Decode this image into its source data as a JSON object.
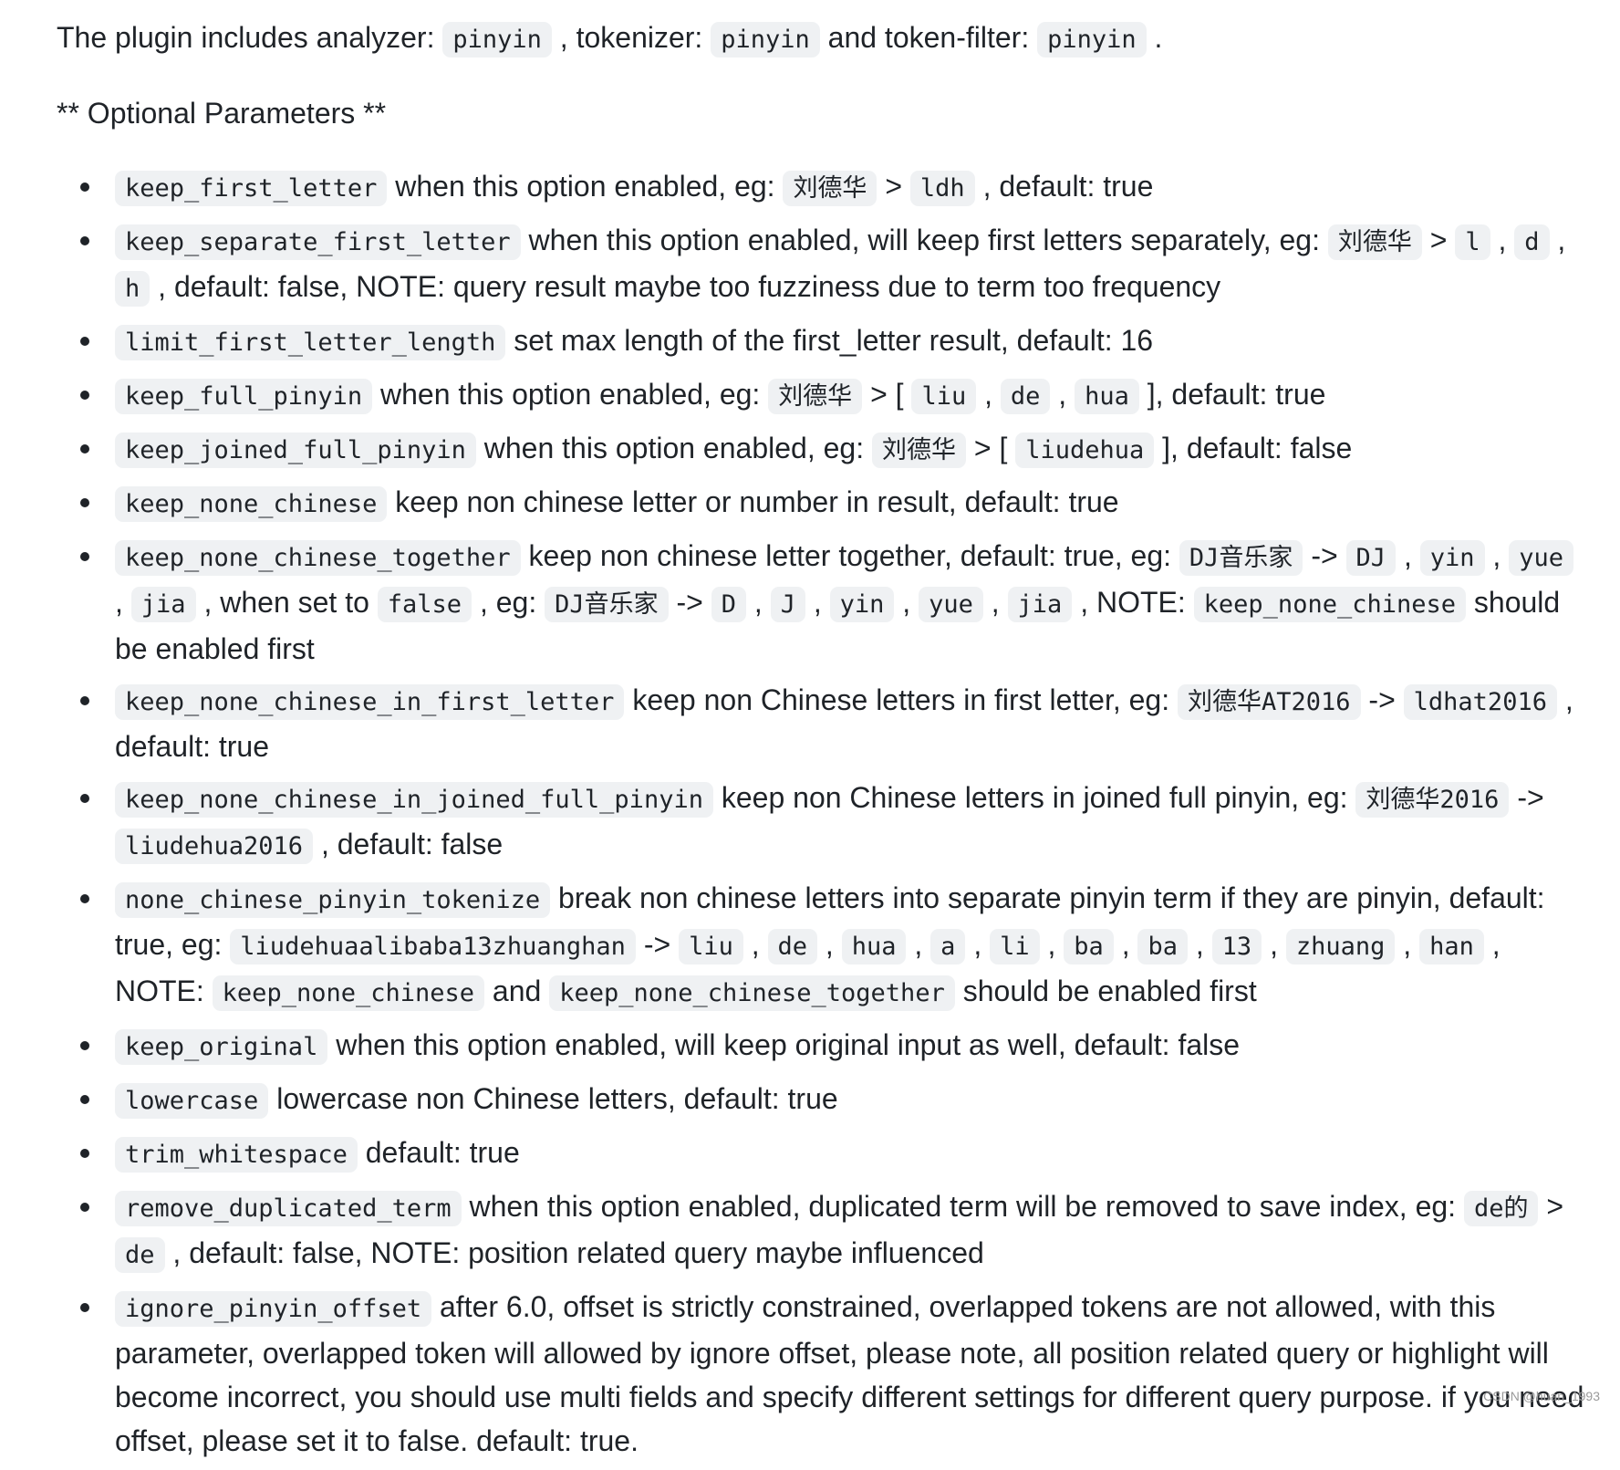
{
  "intro": [
    {
      "t": "text",
      "v": "The plugin includes analyzer: "
    },
    {
      "t": "code",
      "v": "pinyin"
    },
    {
      "t": "text",
      "v": " , tokenizer: "
    },
    {
      "t": "code",
      "v": "pinyin"
    },
    {
      "t": "text",
      "v": " and token-filter: "
    },
    {
      "t": "code",
      "v": "pinyin"
    },
    {
      "t": "text",
      "v": " ."
    }
  ],
  "heading": "** Optional Parameters **",
  "params": [
    {
      "name": "keep_first_letter",
      "segments": [
        {
          "t": "code",
          "v": "keep_first_letter"
        },
        {
          "t": "text",
          "v": " when this option enabled, eg: "
        },
        {
          "t": "code",
          "v": "刘德华"
        },
        {
          "t": "text",
          "v": " > "
        },
        {
          "t": "code",
          "v": "ldh"
        },
        {
          "t": "text",
          "v": " , default: true"
        }
      ]
    },
    {
      "name": "keep_separate_first_letter",
      "segments": [
        {
          "t": "code",
          "v": "keep_separate_first_letter"
        },
        {
          "t": "text",
          "v": " when this option enabled, will keep first letters separately, eg: "
        },
        {
          "t": "code",
          "v": "刘德华"
        },
        {
          "t": "text",
          "v": " > "
        },
        {
          "t": "code",
          "v": "l"
        },
        {
          "t": "text",
          "v": " , "
        },
        {
          "t": "code",
          "v": "d"
        },
        {
          "t": "text",
          "v": " , "
        },
        {
          "t": "code",
          "v": "h"
        },
        {
          "t": "text",
          "v": " , default: false, NOTE: query result maybe too fuzziness due to term too frequency"
        }
      ]
    },
    {
      "name": "limit_first_letter_length",
      "segments": [
        {
          "t": "code",
          "v": "limit_first_letter_length"
        },
        {
          "t": "text",
          "v": " set max length of the first_letter result, default: 16"
        }
      ]
    },
    {
      "name": "keep_full_pinyin",
      "segments": [
        {
          "t": "code",
          "v": "keep_full_pinyin"
        },
        {
          "t": "text",
          "v": " when this option enabled, eg: "
        },
        {
          "t": "code",
          "v": "刘德华"
        },
        {
          "t": "text",
          "v": " > [ "
        },
        {
          "t": "code",
          "v": "liu"
        },
        {
          "t": "text",
          "v": " , "
        },
        {
          "t": "code",
          "v": "de"
        },
        {
          "t": "text",
          "v": " , "
        },
        {
          "t": "code",
          "v": "hua"
        },
        {
          "t": "text",
          "v": " ], default: true"
        }
      ]
    },
    {
      "name": "keep_joined_full_pinyin",
      "segments": [
        {
          "t": "code",
          "v": "keep_joined_full_pinyin"
        },
        {
          "t": "text",
          "v": " when this option enabled, eg: "
        },
        {
          "t": "code",
          "v": "刘德华"
        },
        {
          "t": "text",
          "v": " > [ "
        },
        {
          "t": "code",
          "v": "liudehua"
        },
        {
          "t": "text",
          "v": " ], default: false"
        }
      ]
    },
    {
      "name": "keep_none_chinese",
      "segments": [
        {
          "t": "code",
          "v": "keep_none_chinese"
        },
        {
          "t": "text",
          "v": " keep non chinese letter or number in result, default: true"
        }
      ]
    },
    {
      "name": "keep_none_chinese_together",
      "segments": [
        {
          "t": "code",
          "v": "keep_none_chinese_together"
        },
        {
          "t": "text",
          "v": " keep non chinese letter together, default: true, eg: "
        },
        {
          "t": "code",
          "v": "DJ音乐家"
        },
        {
          "t": "text",
          "v": " -> "
        },
        {
          "t": "code",
          "v": "DJ"
        },
        {
          "t": "text",
          "v": " , "
        },
        {
          "t": "code",
          "v": "yin"
        },
        {
          "t": "text",
          "v": " , "
        },
        {
          "t": "code",
          "v": "yue"
        },
        {
          "t": "text",
          "v": " , "
        },
        {
          "t": "code",
          "v": "jia"
        },
        {
          "t": "text",
          "v": " , when set to "
        },
        {
          "t": "code",
          "v": "false"
        },
        {
          "t": "text",
          "v": " , eg: "
        },
        {
          "t": "code",
          "v": "DJ音乐家"
        },
        {
          "t": "text",
          "v": " -> "
        },
        {
          "t": "code",
          "v": "D"
        },
        {
          "t": "text",
          "v": " , "
        },
        {
          "t": "code",
          "v": "J"
        },
        {
          "t": "text",
          "v": " , "
        },
        {
          "t": "code",
          "v": "yin"
        },
        {
          "t": "text",
          "v": " , "
        },
        {
          "t": "code",
          "v": "yue"
        },
        {
          "t": "text",
          "v": " , "
        },
        {
          "t": "code",
          "v": "jia"
        },
        {
          "t": "text",
          "v": " , NOTE: "
        },
        {
          "t": "code",
          "v": "keep_none_chinese"
        },
        {
          "t": "text",
          "v": " should be enabled first"
        }
      ]
    },
    {
      "name": "keep_none_chinese_in_first_letter",
      "segments": [
        {
          "t": "code",
          "v": "keep_none_chinese_in_first_letter"
        },
        {
          "t": "text",
          "v": " keep non Chinese letters in first letter, eg: "
        },
        {
          "t": "code",
          "v": "刘德华AT2016"
        },
        {
          "t": "text",
          "v": " -> "
        },
        {
          "t": "code",
          "v": "ldhat2016"
        },
        {
          "t": "text",
          "v": " , default: true"
        }
      ]
    },
    {
      "name": "keep_none_chinese_in_joined_full_pinyin",
      "segments": [
        {
          "t": "code",
          "v": "keep_none_chinese_in_joined_full_pinyin"
        },
        {
          "t": "text",
          "v": " keep non Chinese letters in joined full pinyin, eg: "
        },
        {
          "t": "code",
          "v": "刘德华2016"
        },
        {
          "t": "text",
          "v": " -> "
        },
        {
          "t": "code",
          "v": "liudehua2016"
        },
        {
          "t": "text",
          "v": " , default: false"
        }
      ]
    },
    {
      "name": "none_chinese_pinyin_tokenize",
      "segments": [
        {
          "t": "code",
          "v": "none_chinese_pinyin_tokenize"
        },
        {
          "t": "text",
          "v": " break non chinese letters into separate pinyin term if they are pinyin, default: true, eg: "
        },
        {
          "t": "code",
          "v": "liudehuaalibaba13zhuanghan"
        },
        {
          "t": "text",
          "v": " -> "
        },
        {
          "t": "code",
          "v": "liu"
        },
        {
          "t": "text",
          "v": " , "
        },
        {
          "t": "code",
          "v": "de"
        },
        {
          "t": "text",
          "v": " , "
        },
        {
          "t": "code",
          "v": "hua"
        },
        {
          "t": "text",
          "v": " , "
        },
        {
          "t": "code",
          "v": "a"
        },
        {
          "t": "text",
          "v": " , "
        },
        {
          "t": "code",
          "v": "li"
        },
        {
          "t": "text",
          "v": " , "
        },
        {
          "t": "code",
          "v": "ba"
        },
        {
          "t": "text",
          "v": " , "
        },
        {
          "t": "code",
          "v": "ba"
        },
        {
          "t": "text",
          "v": " , "
        },
        {
          "t": "code",
          "v": "13"
        },
        {
          "t": "text",
          "v": " , "
        },
        {
          "t": "code",
          "v": "zhuang"
        },
        {
          "t": "text",
          "v": " , "
        },
        {
          "t": "code",
          "v": "han"
        },
        {
          "t": "text",
          "v": " , NOTE: "
        },
        {
          "t": "code",
          "v": "keep_none_chinese"
        },
        {
          "t": "text",
          "v": " and "
        },
        {
          "t": "code",
          "v": "keep_none_chinese_together"
        },
        {
          "t": "text",
          "v": " should be enabled first"
        }
      ]
    },
    {
      "name": "keep_original",
      "segments": [
        {
          "t": "code",
          "v": "keep_original"
        },
        {
          "t": "text",
          "v": " when this option enabled, will keep original input as well, default: false"
        }
      ]
    },
    {
      "name": "lowercase",
      "segments": [
        {
          "t": "code",
          "v": "lowercase"
        },
        {
          "t": "text",
          "v": " lowercase non Chinese letters, default: true"
        }
      ]
    },
    {
      "name": "trim_whitespace",
      "segments": [
        {
          "t": "code",
          "v": "trim_whitespace"
        },
        {
          "t": "text",
          "v": " default: true"
        }
      ]
    },
    {
      "name": "remove_duplicated_term",
      "segments": [
        {
          "t": "code",
          "v": "remove_duplicated_term"
        },
        {
          "t": "text",
          "v": " when this option enabled, duplicated term will be removed to save index, eg: "
        },
        {
          "t": "code",
          "v": "de的"
        },
        {
          "t": "text",
          "v": " > "
        },
        {
          "t": "code",
          "v": "de"
        },
        {
          "t": "text",
          "v": " , default: false, NOTE: position related query maybe influenced"
        }
      ]
    },
    {
      "name": "ignore_pinyin_offset",
      "segments": [
        {
          "t": "code",
          "v": "ignore_pinyin_offset"
        },
        {
          "t": "text",
          "v": " after 6.0, offset is strictly constrained, overlapped tokens are not allowed, with this parameter, overlapped token will allowed by ignore offset, please note, all position related query or highlight will become incorrect, you should use multi fields and specify different settings for different query purpose. if you need offset, please set it to false. default: true."
        }
      ]
    }
  ],
  "watermark": "CSDN @huan_1993"
}
